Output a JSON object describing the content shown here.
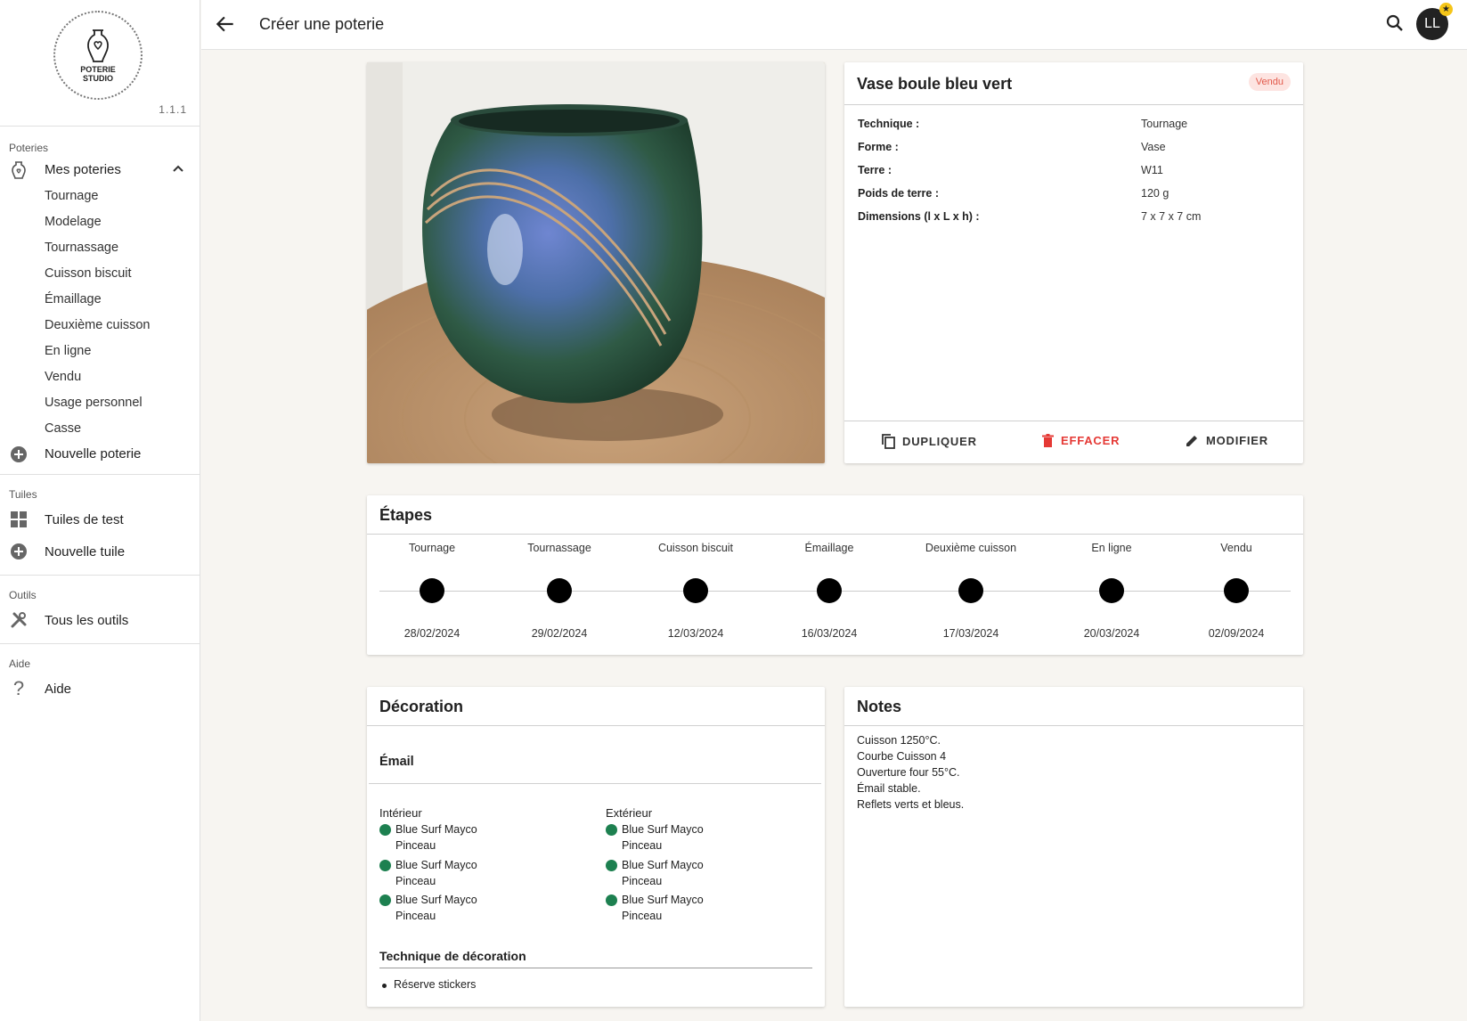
{
  "app": {
    "logo_text_line1": "POTERIE",
    "logo_text_line2": "STUDIO",
    "version": "1.1.1"
  },
  "sidebar": {
    "poteries": {
      "title": "Poteries",
      "main_label": "Mes poteries",
      "items": [
        "Tournage",
        "Modelage",
        "Tournassage",
        "Cuisson biscuit",
        "Émaillage",
        "Deuxième cuisson",
        "En ligne",
        "Vendu",
        "Usage personnel",
        "Casse"
      ],
      "new_label": "Nouvelle poterie"
    },
    "tuiles": {
      "title": "Tuiles",
      "test_label": "Tuiles de test",
      "new_label": "Nouvelle tuile"
    },
    "outils": {
      "title": "Outils",
      "all_label": "Tous les outils"
    },
    "aide": {
      "title": "Aide",
      "label": "Aide"
    }
  },
  "topbar": {
    "title": "Créer une poterie",
    "avatar_initials": "LL",
    "back_icon": "arrow-back-icon",
    "search_icon": "search-icon"
  },
  "pottery": {
    "name": "Vase boule bleu vert",
    "status": "Vendu",
    "specs": [
      {
        "label": "Technique :",
        "value": "Tournage"
      },
      {
        "label": "Forme :",
        "value": "Vase"
      },
      {
        "label": "Terre :",
        "value": "W11"
      },
      {
        "label": "Poids de terre :",
        "value": "120 g"
      },
      {
        "label": "Dimensions (l x L x h) :",
        "value": "7 x 7 x 7 cm"
      }
    ],
    "actions": {
      "duplicate": "DUPLIQUER",
      "delete": "EFFACER",
      "edit": "MODIFIER"
    }
  },
  "steps": {
    "title": "Étapes",
    "items": [
      {
        "label": "Tournage",
        "date": "28/02/2024"
      },
      {
        "label": "Tournassage",
        "date": "29/02/2024"
      },
      {
        "label": "Cuisson biscuit",
        "date": "12/03/2024"
      },
      {
        "label": "Émaillage",
        "date": "16/03/2024"
      },
      {
        "label": "Deuxième cuisson",
        "date": "17/03/2024"
      },
      {
        "label": "En ligne",
        "date": "20/03/2024"
      },
      {
        "label": "Vendu",
        "date": "02/09/2024"
      }
    ]
  },
  "decoration": {
    "title": "Décoration",
    "email_title": "Émail",
    "interior": {
      "title": "Intérieur",
      "glazes": [
        {
          "name": "Blue Surf Mayco",
          "method": "Pinceau"
        },
        {
          "name": "Blue Surf Mayco",
          "method": "Pinceau"
        },
        {
          "name": "Blue Surf Mayco",
          "method": "Pinceau"
        }
      ]
    },
    "exterior": {
      "title": "Extérieur",
      "glazes": [
        {
          "name": "Blue Surf Mayco",
          "method": "Pinceau"
        },
        {
          "name": "Blue Surf Mayco",
          "method": "Pinceau"
        },
        {
          "name": "Blue Surf Mayco",
          "method": "Pinceau"
        }
      ]
    },
    "glaze_color": "#1d8050",
    "technique_title": "Technique de décoration",
    "techniques": [
      "Réserve stickers"
    ]
  },
  "notes": {
    "title": "Notes",
    "lines": [
      "Cuisson 1250°C.",
      "Courbe Cuisson 4",
      "Ouverture four 55°C.",
      "Émail stable.",
      "Reflets verts et bleus."
    ]
  },
  "colors": {
    "danger": "#e53935",
    "badge_bg": "#fde4e1",
    "badge_fg": "#e2594a",
    "background": "#f7f5f1"
  }
}
